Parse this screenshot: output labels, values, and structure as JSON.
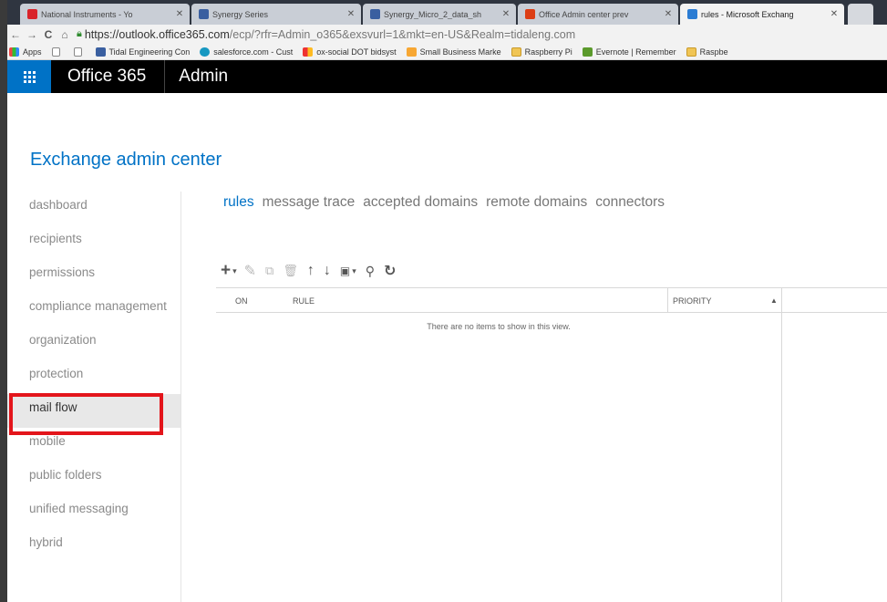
{
  "browser": {
    "tabs": [
      {
        "label": "National Instruments - Yo",
        "color": "#d9232a",
        "active": false
      },
      {
        "label": "Synergy Series",
        "color": "#3a5fa0",
        "active": false
      },
      {
        "label": "Synergy_Micro_2_data_sh",
        "color": "#3a5fa0",
        "active": false
      },
      {
        "label": "Office Admin center prev",
        "color": "#dc3e15",
        "active": false
      },
      {
        "label": "rules - Microsoft Exchang",
        "color": "#2b7cd3",
        "active": true
      }
    ],
    "url_host": "https://outlook.office365.com",
    "url_path": "/ecp/?rfr=Admin_o365&exsvurl=1&mkt=en-US&Realm=tidaleng.com",
    "bookmarks": [
      {
        "label": "Apps",
        "icon": "apps-icon"
      },
      {
        "label": "",
        "icon": "page-icon"
      },
      {
        "label": "",
        "icon": "page-icon"
      },
      {
        "label": "Tidal Engineering Con",
        "icon": "tidal-icon"
      },
      {
        "label": "salesforce.com - Cust",
        "icon": "salesforce-icon"
      },
      {
        "label": "ox-social DOT bidsyst",
        "icon": "ox-icon"
      },
      {
        "label": "Small Business Marke",
        "icon": "smb-icon"
      },
      {
        "label": "Raspberry Pi",
        "icon": "folder-icon"
      },
      {
        "label": "Evernote | Remember",
        "icon": "evernote-icon"
      },
      {
        "label": "Raspbe",
        "icon": "folder-icon"
      }
    ]
  },
  "o365": {
    "title": "Office 365",
    "section": "Admin"
  },
  "page": {
    "title": "Exchange admin center"
  },
  "nav": {
    "items": [
      {
        "label": "dashboard"
      },
      {
        "label": "recipients"
      },
      {
        "label": "permissions"
      },
      {
        "label": "compliance management"
      },
      {
        "label": "organization"
      },
      {
        "label": "protection"
      },
      {
        "label": "mail flow",
        "active": true
      },
      {
        "label": "mobile"
      },
      {
        "label": "public folders"
      },
      {
        "label": "unified messaging"
      },
      {
        "label": "hybrid"
      }
    ]
  },
  "subtabs": [
    "rules",
    "message trace",
    "accepted domains",
    "remote domains",
    "connectors"
  ],
  "grid": {
    "columns": [
      "ON",
      "RULE",
      "PRIORITY"
    ],
    "empty_message": "There are no items to show in this view."
  },
  "colors": {
    "accent": "#0072c6",
    "highlight": "#e3151b"
  }
}
